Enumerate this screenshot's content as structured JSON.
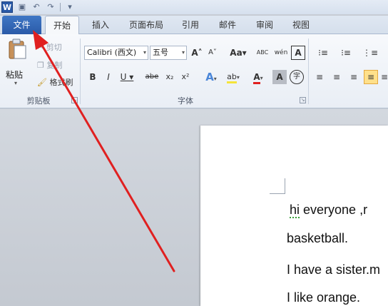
{
  "qat": {
    "app_icon": "W",
    "save_icon": "save-icon",
    "undo_icon": "undo-icon",
    "redo_icon": "redo-icon",
    "customize_icon": "customize-icon"
  },
  "tabs": {
    "file": "文件",
    "home": "开始",
    "insert": "插入",
    "layout": "页面布局",
    "references": "引用",
    "mailings": "邮件",
    "review": "审阅",
    "view": "视图"
  },
  "clipboard": {
    "paste": "粘贴",
    "cut": "剪切",
    "copy": "复制",
    "painter": "格式刷",
    "group": "剪贴板"
  },
  "font": {
    "name": "Calibri (西文)",
    "size": "五号",
    "group": "字体",
    "grow": "A",
    "shrink": "A",
    "case": "Aa",
    "clear": "ABC",
    "phonetic": "wén",
    "border_char": "A",
    "bold": "B",
    "italic": "I",
    "underline": "U",
    "strike": "abe",
    "sub": "x₂",
    "sup": "x²",
    "effects": "A",
    "highlight": "ab",
    "color": "A",
    "shade": "A",
    "enclose": "字"
  },
  "doc": {
    "line1_a": "hi",
    "line1_b": " everyone ,r",
    "line2": "basketball.",
    "line3": "I have a sister.m",
    "line4": "I like orange."
  },
  "colors": {
    "accent": "#2a5aa8",
    "arrow": "#e02020",
    "highlight": "#ffe08a"
  }
}
